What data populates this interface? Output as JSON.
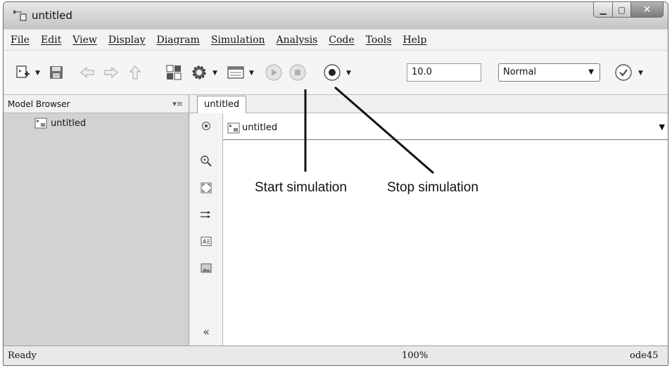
{
  "window": {
    "title": "untitled"
  },
  "menu": [
    "File",
    "Edit",
    "View",
    "Display",
    "Diagram",
    "Simulation",
    "Analysis",
    "Code",
    "Tools",
    "Help"
  ],
  "toolbar": {
    "stop_time": "10.0",
    "sim_mode": "Normal"
  },
  "model_browser": {
    "title": "Model Browser",
    "items": [
      "untitled"
    ]
  },
  "editor": {
    "tab": "untitled",
    "address": "untitled"
  },
  "annotations": {
    "start": "Start simulation",
    "stop": "Stop simulation"
  },
  "status": {
    "left": "Ready",
    "center": "100%",
    "right": "ode45"
  },
  "icons": [
    "model-icon",
    "new-model-icon",
    "save-icon",
    "back-arrow-icon",
    "forward-arrow-icon",
    "up-arrow-icon",
    "library-browser-icon",
    "settings-gear-icon",
    "model-explorer-icon",
    "run-icon",
    "stop-icon",
    "record-icon",
    "check-icon",
    "hide-browser-icon",
    "zoom-icon",
    "fit-view-icon",
    "signal-arrow-icon",
    "annotation-icon",
    "image-icon",
    "collapse-icon"
  ]
}
